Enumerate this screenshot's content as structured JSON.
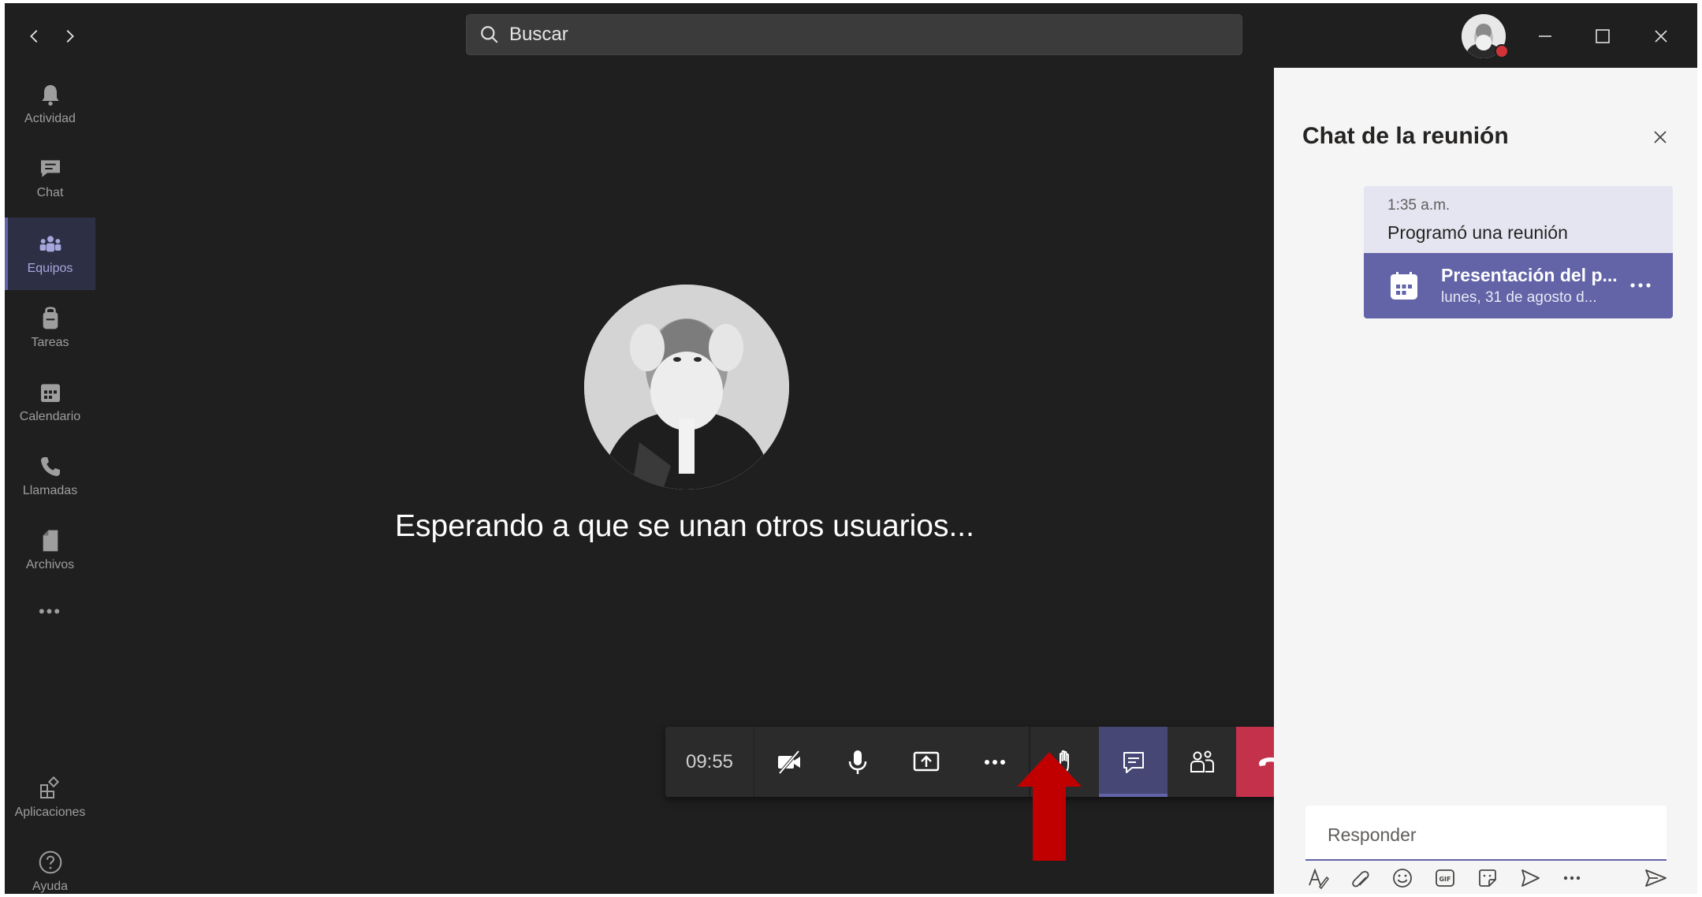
{
  "search": {
    "placeholder": "Buscar"
  },
  "rail": {
    "items": [
      {
        "label": "Actividad",
        "icon": "bell-icon"
      },
      {
        "label": "Chat",
        "icon": "chat-icon"
      },
      {
        "label": "Equipos",
        "icon": "teams-icon",
        "active": true
      },
      {
        "label": "Tareas",
        "icon": "assignments-icon"
      },
      {
        "label": "Calendario",
        "icon": "calendar-icon"
      },
      {
        "label": "Llamadas",
        "icon": "phone-icon"
      },
      {
        "label": "Archivos",
        "icon": "file-icon"
      }
    ],
    "more": "•••",
    "apps_label": "Aplicaciones",
    "help_label": "Ayuda"
  },
  "stage": {
    "waiting_text": "Esperando a que se unan otros usuarios..."
  },
  "toolbar": {
    "timer": "09:55"
  },
  "chat": {
    "title": "Chat de la reunión",
    "message": {
      "time": "1:35 a.m.",
      "text": "Programó una reunión",
      "card_title": "Presentación del p...",
      "card_subtitle": "lunes, 31 de agosto d..."
    },
    "reply_placeholder": "Responder"
  },
  "colors": {
    "accent": "#6264a7",
    "hangup": "#c4314b",
    "annotation_arrow": "#c00000",
    "presence_busy": "#d13438"
  }
}
